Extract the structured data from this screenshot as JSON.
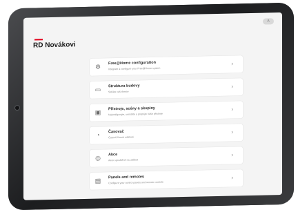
{
  "header": {
    "avatar_text": "A",
    "title": "RD Novákovi"
  },
  "colors": {
    "accent": "#e2001a",
    "background": "#f4f4f4",
    "card": "#ffffff"
  },
  "menu": [
    {
      "icon": "gear-icon",
      "glyph": "⚙",
      "title": "Free@Home configuration",
      "desc": "Integrate & configure your Free@Home system"
    },
    {
      "icon": "building-structure-icon",
      "glyph": "▭",
      "title": "Struktura budovy",
      "desc": "Sefiáte váš domov"
    },
    {
      "icon": "devices-icon",
      "glyph": "▣",
      "title": "Přístroje, scény a skupiny",
      "desc": "Nakonfigurujte, umístěte a propojte Vaše přístroje"
    },
    {
      "icon": "timer-icon",
      "glyph": "◔",
      "title": "Časovač",
      "desc": "Časově řízené události"
    },
    {
      "icon": "actions-icon",
      "glyph": "◎",
      "title": "Akce",
      "desc": "Akce spouštěné na událost"
    },
    {
      "icon": "panel-icon",
      "glyph": "▤",
      "title": "Panels and remotes",
      "desc": "Configure your control panels and remote controls"
    }
  ]
}
